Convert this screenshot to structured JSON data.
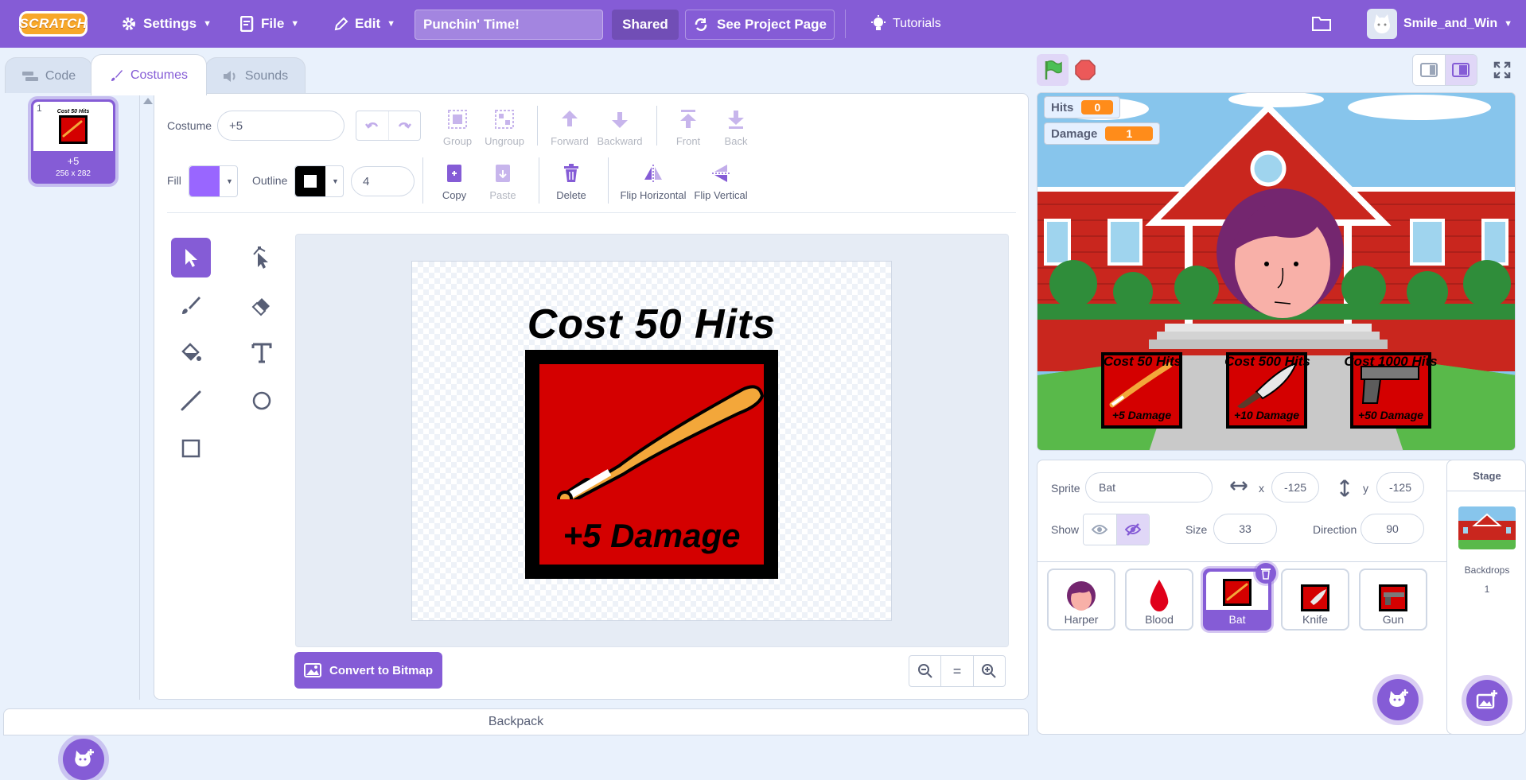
{
  "menu": {
    "logo": "SCRATCH",
    "settings": "Settings",
    "file": "File",
    "edit": "Edit",
    "project_title": "Punchin' Time!",
    "shared": "Shared",
    "see_project_page": "See Project Page",
    "tutorials": "Tutorials",
    "username": "Smile_and_Win"
  },
  "tabs": {
    "code": "Code",
    "costumes": "Costumes",
    "sounds": "Sounds"
  },
  "costume_list": [
    {
      "index": "1",
      "name": "+5",
      "size": "256 x 282",
      "selected": true
    }
  ],
  "editor": {
    "costume_label": "Costume",
    "costume_name": "+5",
    "fill_label": "Fill",
    "fill_color": "#9966ff",
    "outline_label": "Outline",
    "outline_color": "#000000",
    "outline_width": "4",
    "toolbar": {
      "group": "Group",
      "ungroup": "Ungroup",
      "forward": "Forward",
      "backward": "Backward",
      "front": "Front",
      "back": "Back",
      "copy": "Copy",
      "paste": "Paste",
      "delete": "Delete",
      "flip_horizontal": "Flip Horizontal",
      "flip_vertical": "Flip Vertical"
    },
    "canvas": {
      "heading": "Cost 50 Hits",
      "caption": "+5 Damage"
    },
    "convert_button": "Convert to Bitmap",
    "zoom_reset": "="
  },
  "backpack": "Backpack",
  "stage": {
    "monitors": [
      {
        "label": "Hits",
        "value": "0"
      },
      {
        "label": "Damage",
        "value": "1"
      }
    ],
    "shop": [
      {
        "heading": "Cost 50 Hits",
        "caption": "+5 Damage"
      },
      {
        "heading": "Cost 500 Hits",
        "caption": "+10 Damage"
      },
      {
        "heading": "Cost 1000 Hits",
        "caption": "+50 Damage"
      }
    ]
  },
  "sprite_info": {
    "sprite_label": "Sprite",
    "sprite_name": "Bat",
    "x_label": "x",
    "x_value": "-125",
    "y_label": "y",
    "y_value": "-125",
    "show_label": "Show",
    "size_label": "Size",
    "size_value": "33",
    "direction_label": "Direction",
    "direction_value": "90"
  },
  "sprites": [
    {
      "name": "Harper",
      "selected": false
    },
    {
      "name": "Blood",
      "selected": false
    },
    {
      "name": "Bat",
      "selected": true
    },
    {
      "name": "Knife",
      "selected": false
    },
    {
      "name": "Gun",
      "selected": false
    }
  ],
  "stage_panel": {
    "title": "Stage",
    "backdrops_label": "Backdrops",
    "backdrops_count": "1"
  },
  "colors": {
    "accent": "#855cd6",
    "red": "#d40000",
    "orange": "#ff8c1a"
  }
}
